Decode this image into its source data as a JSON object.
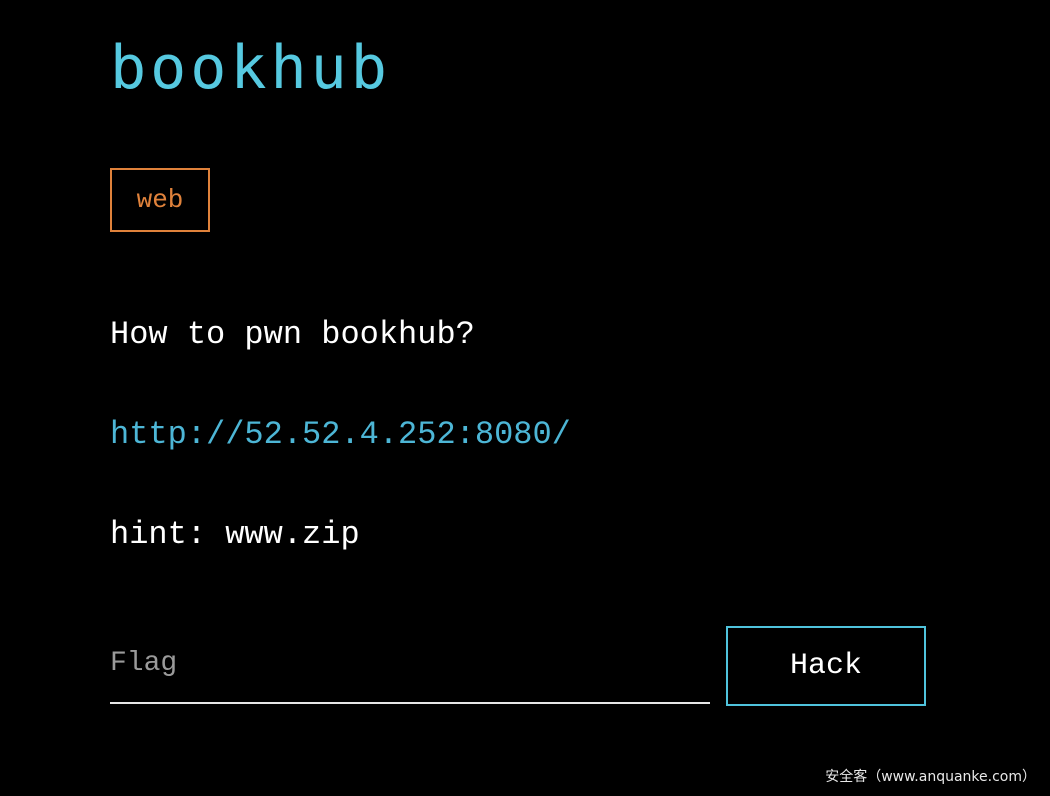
{
  "challenge": {
    "title": "bookhub",
    "category": "web",
    "question": "How to pwn bookhub?",
    "link": "http://52.52.4.252:8080/",
    "hint": "hint: www.zip"
  },
  "submission": {
    "flag_placeholder": "Flag",
    "flag_value": "",
    "submit_label": "Hack"
  },
  "watermark": "安全客（www.anquanke.com）",
  "colors": {
    "background": "#000000",
    "title": "#56c9e0",
    "category": "#e0823b",
    "link": "#4db6d6",
    "button_border": "#4fc3dc",
    "text": "#ffffff",
    "placeholder": "#9a9a9a"
  }
}
